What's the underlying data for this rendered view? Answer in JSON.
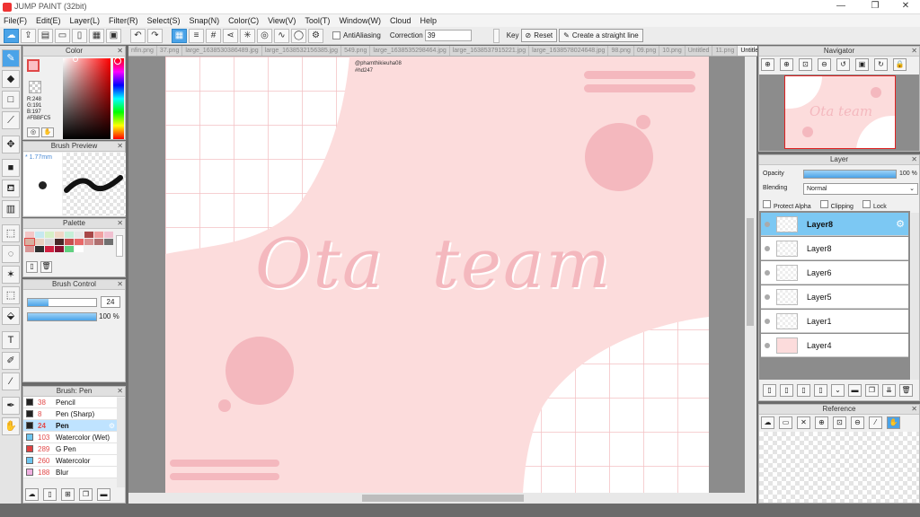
{
  "window": {
    "title": "JUMP PAINT (32bit)",
    "controls": [
      "—",
      "❐",
      "✕"
    ]
  },
  "menu": [
    "File(F)",
    "Edit(E)",
    "Layer(L)",
    "Filter(R)",
    "Select(S)",
    "Snap(N)",
    "Color(C)",
    "View(V)",
    "Tool(T)",
    "Window(W)",
    "Cloud",
    "Help"
  ],
  "toolbar": {
    "antialias_label": "AntiAliasing",
    "correction_label": "Correction",
    "correction_value": "39",
    "key_label": "Key",
    "reset_label": "Reset",
    "straight_line_label": "Create a straight line"
  },
  "tabs": [
    "nfin.png",
    "37.png",
    "large_1638530386489.jpg",
    "large_1638532156385.jpg",
    "549.png",
    "large_1638535298464.jpg",
    "large_1638537915221.jpg",
    "large_1638578024648.jpg",
    "98.png",
    "09.png",
    "10.png",
    "Untitled",
    "11.png",
    "Untitled"
  ],
  "color_panel": {
    "title": "Color",
    "r": "R:248",
    "g": "G:191",
    "b": "B:197",
    "hex": "#FBBFC5",
    "accent": "#FBBFC5"
  },
  "brush_preview": {
    "title": "Brush Preview",
    "size": "1.77mm"
  },
  "palette": {
    "title": "Palette",
    "colors": [
      "#f4c6c6",
      "#c6e8f0",
      "#d6f0c6",
      "#f0d8c6",
      "#c6f0d8",
      "#e8e8e8",
      "#a84848",
      "#f0a0a0",
      "#f0c0d0",
      "#d8b0a0",
      "#e8d0c0",
      "#d8d8d8",
      "#482828",
      "#c85050",
      "#e86868",
      "#d89090",
      "#b07070",
      "#707070",
      "#d89898",
      "#303030",
      "#d02040",
      "#8b1030",
      "#60d080",
      "#ffffff"
    ]
  },
  "brush_control": {
    "title": "Brush Control",
    "size": "24",
    "opacity": "100 %",
    "size_fill": 0.3,
    "opacity_fill": 1.0
  },
  "brush_list": {
    "title": "Brush: Pen",
    "items": [
      {
        "num": "38",
        "label": "Pencil",
        "color": "#222222"
      },
      {
        "num": "8",
        "label": "Pen (Sharp)",
        "color": "#222222"
      },
      {
        "num": "24",
        "label": "Pen",
        "color": "#222222",
        "active": true
      },
      {
        "num": "103",
        "label": "Watercolor (Wet)",
        "color": "#6ec6f0"
      },
      {
        "num": "289",
        "label": "G Pen",
        "color": "#e04040"
      },
      {
        "num": "260",
        "label": "Watercolor",
        "color": "#6ec6f0"
      },
      {
        "num": "188",
        "label": "Blur",
        "color": "#f0b0e0"
      }
    ]
  },
  "canvas": {
    "credit1": "@phamthikieuha08",
    "credit2": "#hd247",
    "title_text": "Ota  team",
    "bg": "#fcdcdc",
    "accent": "#f4b8be"
  },
  "navigator": {
    "title": "Navigator",
    "text": "Ota team"
  },
  "layer_panel": {
    "title": "Layer",
    "opacity_label": "Opacity",
    "opacity_value": "100 %",
    "opacity_fill": 1.0,
    "blending_label": "Blending",
    "blending_value": "Normal",
    "protect_alpha": "Protect Alpha",
    "clipping": "Clipping",
    "lock": "Lock",
    "layers": [
      {
        "name": "Layer8",
        "active": true
      },
      {
        "name": "Layer8"
      },
      {
        "name": "Layer6"
      },
      {
        "name": "Layer5"
      },
      {
        "name": "Layer1"
      },
      {
        "name": "Layer4"
      }
    ]
  },
  "reference": {
    "title": "Reference"
  }
}
